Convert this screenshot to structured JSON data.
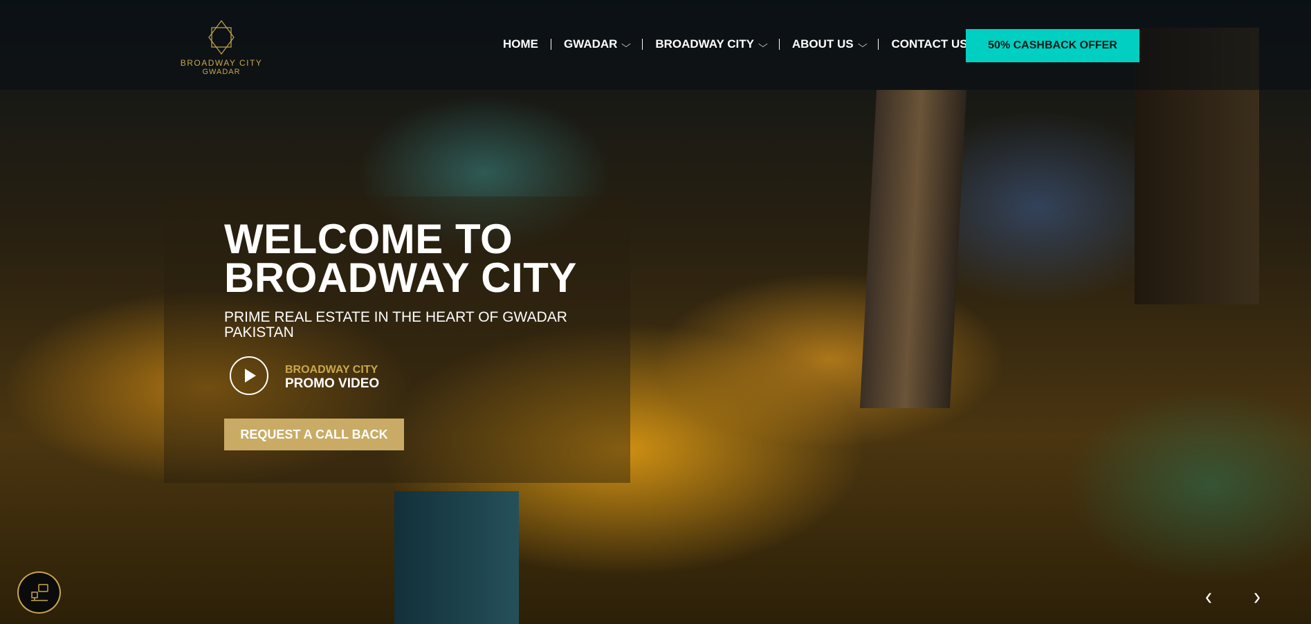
{
  "logo": {
    "line1": "BROADWAY CITY",
    "line2": "GWADAR"
  },
  "nav": {
    "items": [
      {
        "label": "HOME",
        "dropdown": false
      },
      {
        "label": "GWADAR",
        "dropdown": true
      },
      {
        "label": "BROADWAY CITY",
        "dropdown": true
      },
      {
        "label": "ABOUT US",
        "dropdown": true
      },
      {
        "label": "CONTACT US",
        "dropdown": false
      }
    ]
  },
  "cta": {
    "label": "50% CASHBACK OFFER",
    "color": "#00cfc1"
  },
  "hero": {
    "title_line1": "WELCOME TO",
    "title_line2": "BROADWAY CITY",
    "subtitle_line1": "PRIME REAL ESTATE IN THE HEART OF GWADAR",
    "subtitle_line2": "PAKISTAN",
    "promo_line1": "BROADWAY CITY",
    "promo_line2": "PROMO VIDEO",
    "callback_label": "REQUEST A CALL BACK"
  },
  "slider": {
    "prev": "‹",
    "next": "›"
  },
  "colors": {
    "gold": "#c9a84c",
    "button_gold": "#c9ab65"
  }
}
